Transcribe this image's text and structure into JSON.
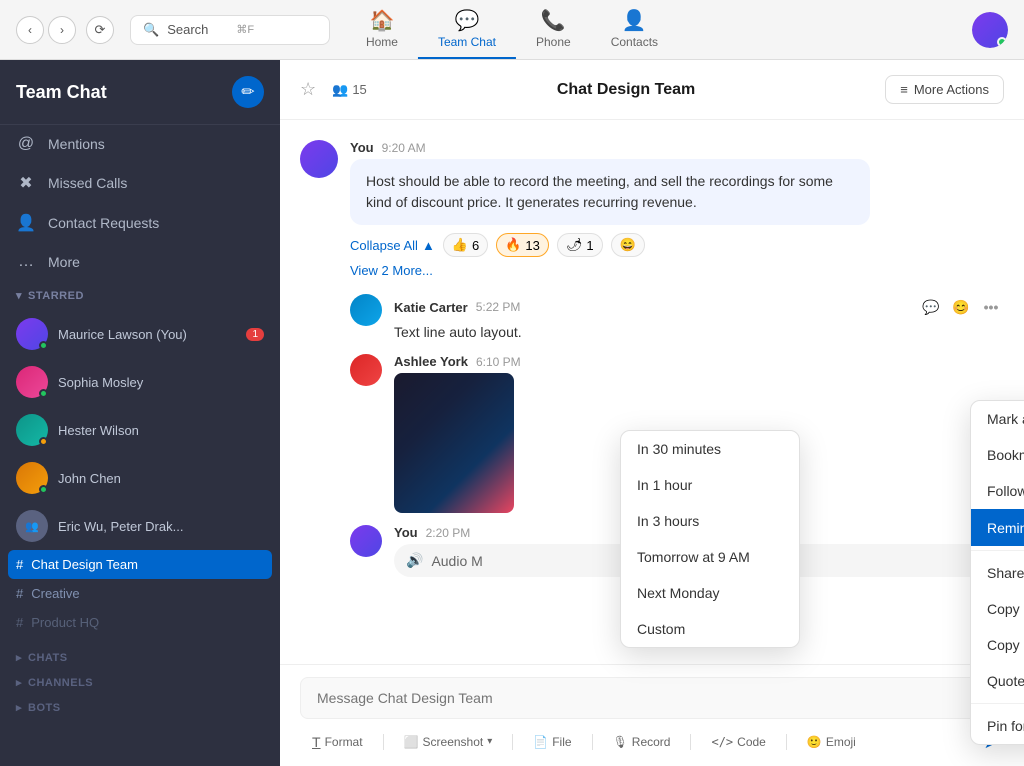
{
  "topNav": {
    "back_label": "‹",
    "forward_label": "›",
    "history_label": "⟳",
    "search_placeholder": "Search",
    "search_shortcut": "⌘F",
    "tabs": [
      {
        "id": "home",
        "label": "Home",
        "icon": "🏠",
        "active": false
      },
      {
        "id": "team-chat",
        "label": "Team Chat",
        "icon": "💬",
        "active": true
      },
      {
        "id": "phone",
        "label": "Phone",
        "icon": "📞",
        "active": false
      },
      {
        "id": "contacts",
        "label": "Contacts",
        "icon": "👤",
        "active": false
      }
    ]
  },
  "sidebar": {
    "title": "Team Chat",
    "compose_icon": "✏",
    "items": [
      {
        "id": "mentions",
        "label": "Mentions",
        "icon": "@"
      },
      {
        "id": "missed-calls",
        "label": "Missed Calls",
        "icon": "✖"
      },
      {
        "id": "contact-requests",
        "label": "Contact Requests",
        "icon": "👤"
      },
      {
        "id": "more",
        "label": "More",
        "icon": "…"
      }
    ],
    "starred_label": "STARRED",
    "starred_arrow": "▾",
    "starred_contacts": [
      {
        "id": "maurice",
        "name": "Maurice Lawson (You)",
        "status": "online",
        "badge": "1"
      },
      {
        "id": "sophia",
        "name": "Sophia Mosley",
        "status": "online",
        "badge": null
      },
      {
        "id": "hester",
        "name": "Hester Wilson",
        "status": "away",
        "badge": null
      },
      {
        "id": "john",
        "name": "John Chen",
        "status": "online",
        "badge": null
      },
      {
        "id": "eric",
        "name": "Eric Wu, Peter Drak...",
        "status": null,
        "badge": null
      }
    ],
    "channels": [
      {
        "id": "chat-design-team",
        "label": "Chat Design Team",
        "active": true
      },
      {
        "id": "creative",
        "label": "Creative",
        "active": false
      },
      {
        "id": "product-hq",
        "label": "Product HQ",
        "active": false,
        "muted": true
      }
    ],
    "sections": {
      "chats": "CHATS",
      "channels": "CHANNELS",
      "bots": "BOTS"
    }
  },
  "chat": {
    "title": "Chat Design Team",
    "members_count": "15",
    "members_icon": "👥",
    "more_actions_label": "More Actions",
    "messages": [
      {
        "id": "msg1",
        "sender": "You",
        "time": "9:20 AM",
        "text": "Host should be able to record the meeting, and sell the recordings for some kind of discount price. It generates recurring revenue.",
        "reactions": [
          {
            "emoji": "👍",
            "count": "6"
          },
          {
            "emoji": "🔥",
            "count": "13"
          },
          {
            "emoji": "🌶",
            "count": "1"
          },
          {
            "emoji": "😄",
            "count": null
          }
        ],
        "collapse_label": "Collapse All",
        "view_more": "View 2 More..."
      }
    ],
    "reply1": {
      "sender": "Katie Carter",
      "time": "5:22 PM",
      "text": "Text line auto layout.",
      "reply_icon": "💬",
      "emoji_icon": "😊",
      "more_icon": "•••"
    },
    "reply2": {
      "sender": "Ashlee York",
      "time": "6:10 PM"
    },
    "msg_you": {
      "sender": "You",
      "time": "2:20 PM",
      "audio_label": "Audio M"
    },
    "input_placeholder": "Message Chat Design Team",
    "toolbar_items": [
      {
        "id": "format",
        "label": "Format",
        "icon": "T̲"
      },
      {
        "id": "screenshot",
        "label": "Screenshot",
        "icon": "⬜"
      },
      {
        "id": "file",
        "label": "File",
        "icon": "📄"
      },
      {
        "id": "record",
        "label": "Record",
        "icon": "🎙"
      },
      {
        "id": "code",
        "label": "Code",
        "icon": "</>"
      },
      {
        "id": "emoji",
        "label": "Emoji",
        "icon": "🙂"
      }
    ],
    "send_icon": "➤"
  },
  "contextMenu": {
    "items": [
      {
        "id": "mark-unread",
        "label": "Mark as Unread",
        "active": false
      },
      {
        "id": "bookmark",
        "label": "Bookmark",
        "active": false
      },
      {
        "id": "follow-message",
        "label": "Follow Message",
        "active": false
      },
      {
        "id": "remind-me",
        "label": "Remind Me",
        "active": true,
        "has_arrow": true
      },
      {
        "id": "share-message",
        "label": "Share Message...",
        "active": false
      },
      {
        "id": "copy-link",
        "label": "Copy Link to Message",
        "active": false
      },
      {
        "id": "copy",
        "label": "Copy",
        "active": false
      },
      {
        "id": "quote",
        "label": "Quote",
        "active": false
      },
      {
        "id": "pin",
        "label": "Pin for Everyone",
        "active": false
      }
    ]
  },
  "subMenu": {
    "items": [
      {
        "id": "30min",
        "label": "In 30 minutes"
      },
      {
        "id": "1hour",
        "label": "In 1 hour"
      },
      {
        "id": "3hours",
        "label": "In 3 hours"
      },
      {
        "id": "tomorrow",
        "label": "Tomorrow at 9 AM"
      },
      {
        "id": "monday",
        "label": "Next Monday"
      },
      {
        "id": "custom",
        "label": "Custom"
      }
    ]
  }
}
